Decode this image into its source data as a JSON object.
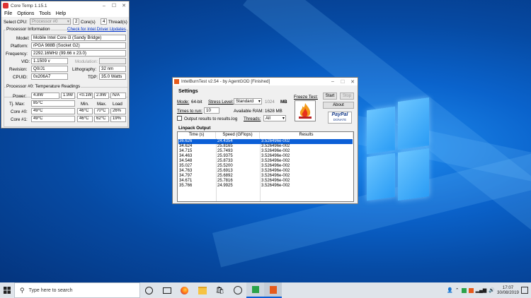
{
  "colors": {
    "accent": "#0b5fd7",
    "desktop": "#0a63cc",
    "taskbar": "#dfe4ea"
  },
  "coretemp": {
    "title": "Core Temp 1.15.1",
    "menu": [
      "File",
      "Options",
      "Tools",
      "Help"
    ],
    "select_cpu_label": "Select CPU:",
    "processor_value": "Processor #0",
    "cores_value": "2",
    "cores_label": "Core(s)",
    "threads_value": "4",
    "threads_label": "Thread(s)",
    "info_group": "Processor Information",
    "driver_link": "Check for Intel Driver Updates",
    "model_label": "Model:",
    "model_value": "Mobile Intel Core i3 (Sandy Bridge)",
    "platform_label": "Platform:",
    "platform_value": "rPGA 988B (Socket G2)",
    "frequency_label": "Frequency:",
    "frequency_value": "2292.16MHz (99.66 x 23.0)",
    "vid_label": "VID:",
    "vid_value": "1.1509 v",
    "modulation_label": "Modulation:",
    "revision_label": "Revision:",
    "revision_value": "Q0/J1",
    "lithography_label": "Lithography:",
    "lithography_value": "32 nm",
    "cpuid_label": "CPUID:",
    "cpuid_value": "0x206A7",
    "tdp_label": "TDP:",
    "tdp_value": "35.0 Watts",
    "temp_group": "Processor #0: Temperature Readings",
    "power_label": "Power:",
    "power_values": [
      "4.8W",
      "1.9W",
      "<0.1W",
      "2.9W",
      "N/A"
    ],
    "tjmax_label": "Tj. Max:",
    "tjmax_value": "85°C",
    "col_min": "Min.",
    "col_max": "Max.",
    "col_load": "Load",
    "cores": [
      {
        "label": "Core #0:",
        "temp": "49°C",
        "min": "46°C",
        "max": "70°C",
        "load": "26%"
      },
      {
        "label": "Core #1:",
        "temp": "49°C",
        "min": "46°C",
        "max": "62°C",
        "load": "19%"
      }
    ]
  },
  "ibt": {
    "title": "IntelBurnTest v2.54 - by AgentGOD [Finished]",
    "settings_label": "Settings",
    "mode_label": "Mode:",
    "mode_value": "64-bit",
    "stress_label": "Stress Level:",
    "stress_value": "Standard",
    "mb_value": "1024",
    "mb_unit": "MB",
    "times_label": "Times to run:",
    "times_value": "10",
    "ram_label": "Available RAM:",
    "ram_value": "1628 MB",
    "output_checkbox": "Output results to results.log",
    "threads_label": "Threads:",
    "threads_value": "All",
    "freeze_label": "Freeze Test:",
    "start_btn": "Start",
    "stop_btn": "Stop",
    "about_btn": "About",
    "paypal_text": "PayPal",
    "donate_text": "DONATE",
    "output_label": "Linpack Output",
    "col_time": "Time (s)",
    "col_speed": "Speed (GFlops)",
    "col_results": "Results",
    "rows": [
      {
        "time": "36.626",
        "speed": "24.4354",
        "result": "3.526496e-002"
      },
      {
        "time": "34.624",
        "speed": "25.8165",
        "result": "3.526496e-002"
      },
      {
        "time": "34.715",
        "speed": "25.7493",
        "result": "3.526496e-002"
      },
      {
        "time": "34.463",
        "speed": "25.9375",
        "result": "3.526496e-002"
      },
      {
        "time": "34.548",
        "speed": "25.8733",
        "result": "3.526496e-002"
      },
      {
        "time": "35.027",
        "speed": "25.5200",
        "result": "3.526496e-002"
      },
      {
        "time": "34.763",
        "speed": "25.6913",
        "result": "3.526496e-002"
      },
      {
        "time": "34.797",
        "speed": "25.6892",
        "result": "3.526496e-002"
      },
      {
        "time": "34.671",
        "speed": "25.7816",
        "result": "3.526496e-002"
      },
      {
        "time": "35.766",
        "speed": "24.9925",
        "result": "3.526496e-002"
      }
    ]
  },
  "taskbar": {
    "search_placeholder": "Type here to search",
    "time": "17:07",
    "date": "30/08/2019"
  }
}
